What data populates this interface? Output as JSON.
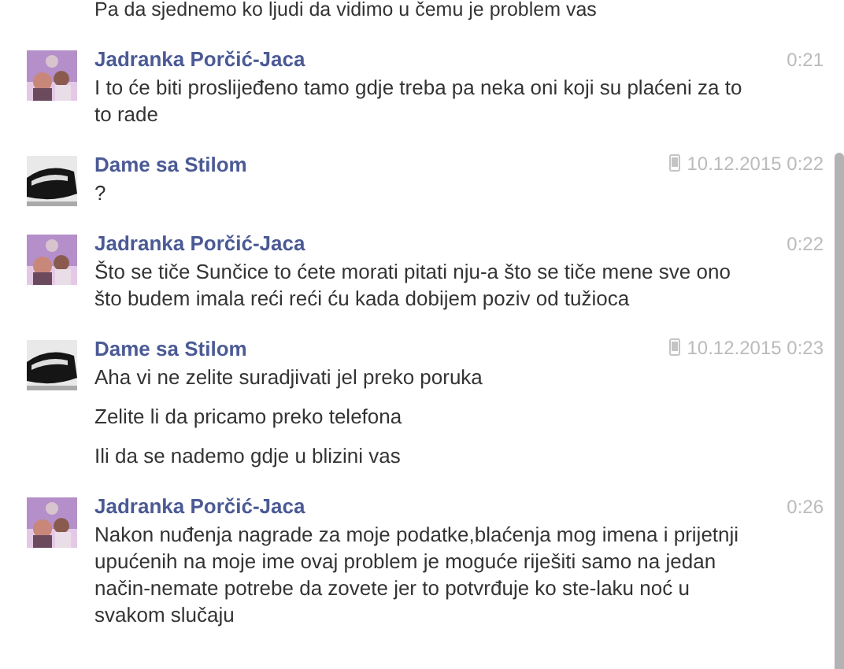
{
  "previous_text": "Pa da sjednemo ko ljudi da vidimo u čemu je problem vas",
  "messages": [
    {
      "sender": "Jadranka Porčić-Jaca",
      "time": "0:21",
      "via_mobile": false,
      "paragraphs": [
        "I to će biti proslijeđeno tamo gdje treba pa neka oni koji su plaćeni za to to rade"
      ]
    },
    {
      "sender": "Dame sa Stilom",
      "time": "10.12.2015 0:22",
      "via_mobile": true,
      "paragraphs": [
        "?"
      ]
    },
    {
      "sender": "Jadranka Porčić-Jaca",
      "time": "0:22",
      "via_mobile": false,
      "paragraphs": [
        "Što se tiče Sunčice to ćete morati pitati nju-a što se tiče mene sve ono što budem imala reći reći ću kada dobijem poziv od tužioca"
      ]
    },
    {
      "sender": "Dame sa Stilom",
      "time": "10.12.2015 0:23",
      "via_mobile": true,
      "paragraphs": [
        "Aha vi ne zelite suradjivati jel preko poruka",
        "Zelite li da pricamo preko telefona",
        "Ili da se nademo gdje u blizini vas"
      ]
    },
    {
      "sender": "Jadranka Porčić-Jaca",
      "time": "0:26",
      "via_mobile": false,
      "paragraphs": [
        "Nakon nuđenja nagrade za moje podatke,blaćenja mog imena i prijetnji upućenih na moje ime ovaj problem je moguće riješiti samo na jedan način-nemate potrebe da zovete jer to potvrđuje ko ste-laku noć u svakom slučaju"
      ]
    }
  ]
}
